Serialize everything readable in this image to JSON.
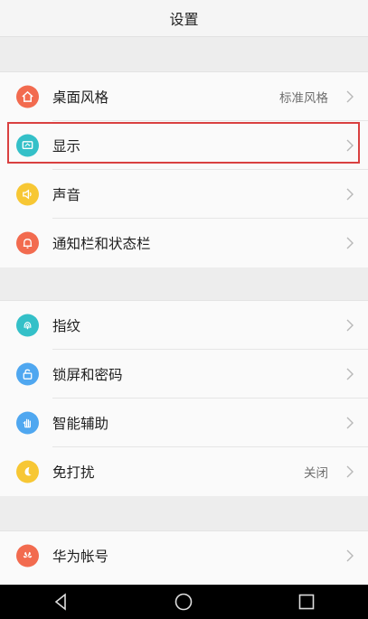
{
  "header": {
    "title": "设置"
  },
  "groups": [
    {
      "items": [
        {
          "label": "桌面风格",
          "value": "标准风格",
          "icon": "home-icon",
          "color": "#f26b4f"
        },
        {
          "label": "显示",
          "value": "",
          "icon": "display-icon",
          "color": "#34c0c8",
          "highlighted": true
        },
        {
          "label": "声音",
          "value": "",
          "icon": "speaker-icon",
          "color": "#f7c734"
        },
        {
          "label": "通知栏和状态栏",
          "value": "",
          "icon": "bell-icon",
          "color": "#f26b4f"
        }
      ]
    },
    {
      "items": [
        {
          "label": "指纹",
          "value": "",
          "icon": "fingerprint-icon",
          "color": "#34c0c8"
        },
        {
          "label": "锁屏和密码",
          "value": "",
          "icon": "lock-icon",
          "color": "#4fa7f0"
        },
        {
          "label": "智能辅助",
          "value": "",
          "icon": "hand-icon",
          "color": "#4fa7f0"
        },
        {
          "label": "免打扰",
          "value": "关闭",
          "icon": "moon-icon",
          "color": "#f7c734"
        }
      ]
    },
    {
      "items": [
        {
          "label": "华为帐号",
          "value": "",
          "icon": "huawei-logo-icon",
          "color": "#f26b4f"
        }
      ]
    }
  ],
  "navbar": {
    "buttons": [
      "back-icon",
      "home-circle-icon",
      "recents-icon"
    ]
  }
}
